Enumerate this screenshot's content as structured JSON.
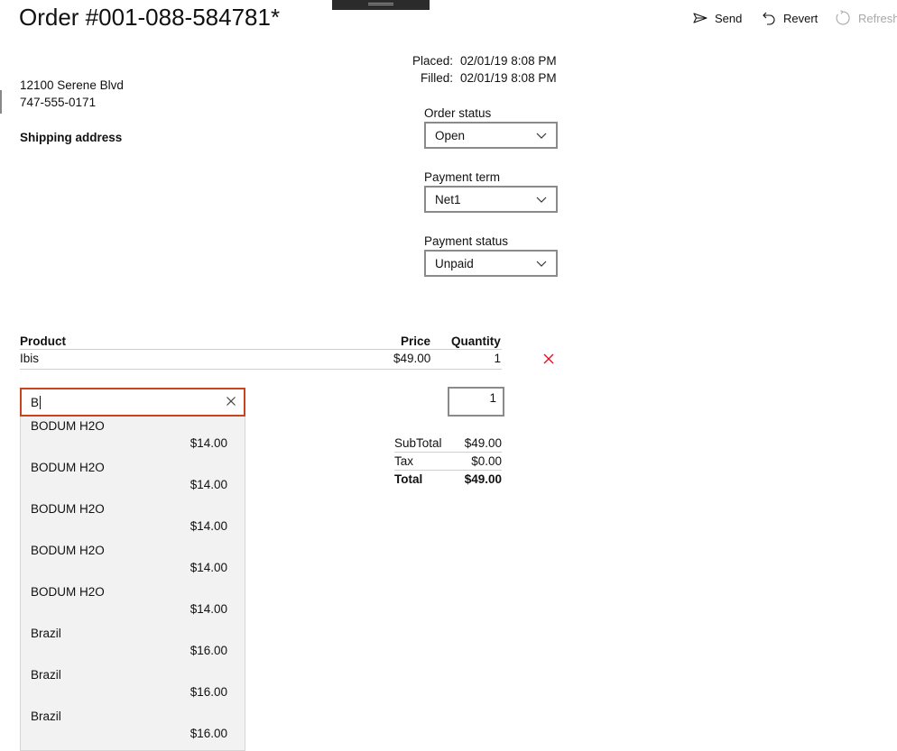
{
  "window": {
    "title": "Order #001-088-584781*"
  },
  "commands": {
    "send_label": "Send",
    "revert_label": "Revert",
    "refresh_label": "Refresh"
  },
  "customer": {
    "address": "12100 Serene Blvd",
    "phone": "747-555-0171",
    "shipping_label": "Shipping address"
  },
  "dates": {
    "placed_label": "Placed:",
    "placed_value": "02/01/19 8:08 PM",
    "filled_label": "Filled:",
    "filled_value": "02/01/19 8:08 PM"
  },
  "order_status": {
    "label": "Order status",
    "value": "Open"
  },
  "payment_term": {
    "label": "Payment term",
    "value": "Net1"
  },
  "payment_status": {
    "label": "Payment status",
    "value": "Unpaid"
  },
  "line_items": {
    "headers": {
      "product": "Product",
      "price": "Price",
      "quantity": "Quantity"
    },
    "rows": [
      {
        "product": "Ibis",
        "price": "$49.00",
        "quantity": "1"
      }
    ]
  },
  "new_item": {
    "search_value": "B",
    "quantity": "1",
    "suggestions": [
      {
        "name": "BODUM H2O",
        "price": "$14.00"
      },
      {
        "name": "BODUM H2O",
        "price": "$14.00"
      },
      {
        "name": "BODUM H2O",
        "price": "$14.00"
      },
      {
        "name": "BODUM H2O",
        "price": "$14.00"
      },
      {
        "name": "BODUM H2O",
        "price": "$14.00"
      },
      {
        "name": "Brazil",
        "price": "$16.00"
      },
      {
        "name": "Brazil",
        "price": "$16.00"
      },
      {
        "name": "Brazil",
        "price": "$16.00"
      }
    ]
  },
  "totals": {
    "subtotal_label": "SubTotal",
    "subtotal_value": "$49.00",
    "tax_label": "Tax",
    "tax_value": "$0.00",
    "total_label": "Total",
    "total_value": "$49.00"
  },
  "colors": {
    "accent_border": "#c8441f",
    "delete_icon": "#e81123"
  },
  "icons": {
    "send": "send-icon",
    "revert": "undo-icon",
    "refresh": "refresh-icon",
    "dropdown": "chevron-down-icon",
    "clear": "close-icon",
    "delete": "delete-x-icon"
  }
}
